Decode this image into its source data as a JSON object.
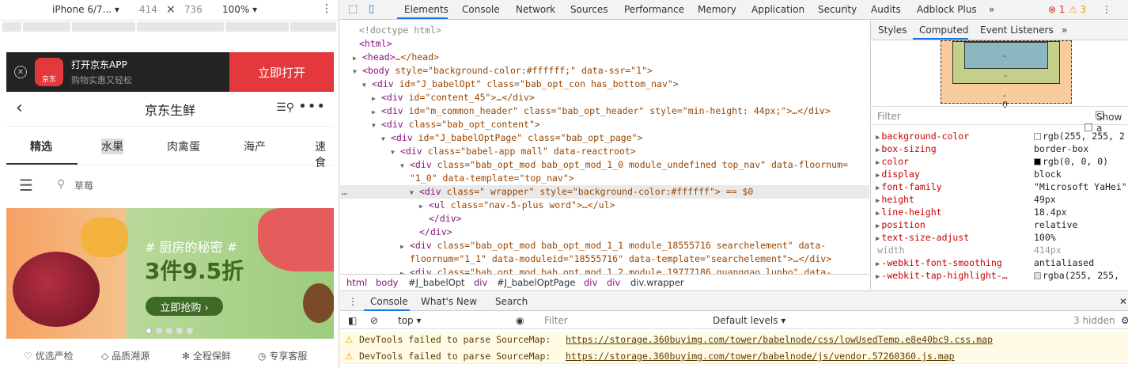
{
  "device_toolbar": {
    "device": "iPhone 6/7... ▾",
    "width": "414",
    "times": "×",
    "height": "736",
    "zoom": "100% ▾",
    "more": "⋮"
  },
  "phone": {
    "app_banner": {
      "close": "✕",
      "logo": "京东",
      "title": "打开京东APP",
      "subtitle": "购物实惠又轻松",
      "open_button": "立即打开"
    },
    "header": {
      "back": "‹",
      "title": "京东生鲜",
      "search_menu": "☰⚲",
      "more": "•••"
    },
    "categories": [
      {
        "label": "精选"
      },
      {
        "label": "水果"
      },
      {
        "label": "肉禽蛋"
      },
      {
        "label": "海产"
      },
      {
        "label": "速食"
      }
    ],
    "search": {
      "menu": "☰",
      "icon": "⚲",
      "placeholder": "草莓"
    },
    "banner": {
      "tag": "# 厨房的秘密 #",
      "headline": "3件9.5折",
      "button": "立即抢购 ›",
      "active_dot": 0,
      "dot_count": 5
    },
    "trust": [
      {
        "icon": "♡",
        "label": "优选严检"
      },
      {
        "icon": "◇",
        "label": "品质溯源"
      },
      {
        "icon": "✻",
        "label": "全程保鲜"
      },
      {
        "icon": "◷",
        "label": "专享客服"
      }
    ]
  },
  "devtools": {
    "tabs": [
      "Elements",
      "Console",
      "Network",
      "Sources",
      "Performance",
      "Memory",
      "Application",
      "Security",
      "Audits",
      "Adblock Plus",
      "»"
    ],
    "errors": "⊗ 1",
    "warnings": "⚠ 3",
    "more": "⋮",
    "close": "✕",
    "elements": [
      {
        "prefix": "",
        "tag": "<!doctype html>",
        "rest": ""
      },
      {
        "prefix": "",
        "tag": "<html>",
        "rest": ""
      },
      {
        "prefix": "▶",
        "tag": "<head>",
        "rest": "…</head>"
      },
      {
        "prefix": "▼",
        "tag": "<body",
        "rest": " style=\"background-color:#ffffff;\" data-ssr=\"1\">"
      },
      {
        "prefix": "▼",
        "tag": "<div",
        "rest": " id=\"J_babelOpt\" class=\"bab_opt_con  has_bottom_nav\">"
      },
      {
        "prefix": "▶",
        "tag": "<div",
        "rest": " id=\"content_45\">…</div>"
      },
      {
        "prefix": "▶",
        "tag": "<div",
        "rest": " id=\"m_common_header\" class=\"bab_opt_header\" style=\"min-height: 44px;\">…</div>"
      },
      {
        "prefix": "▼",
        "tag": "<div",
        "rest": " class=\"bab_opt_content\">"
      },
      {
        "prefix": "▼",
        "tag": "<div",
        "rest": " id=\"J_babelOptPage\" class=\"bab_opt_page\">"
      },
      {
        "prefix": "▼",
        "tag": "<div",
        "rest": " class=\"babel-app mall\" data-reactroot>"
      },
      {
        "prefix": "▼",
        "tag": "<div",
        "rest": " class=\"bab_opt_mod bab_opt_mod_1_0 module_undefined top_nav\" data-floornum="
      },
      {
        "prefix": "",
        "tag": "",
        "rest": "\"1_0\" data-template=\"top_nav\">"
      },
      {
        "prefix": "▼",
        "tag": "<div",
        "rest": " class=\" wrapper\" style=\"background-color:#ffffff\"> == $0"
      },
      {
        "prefix": "▶",
        "tag": "<ul",
        "rest": " class=\"nav-5-plus word\">…</ul>"
      },
      {
        "prefix": "",
        "tag": "</div>",
        "rest": ""
      },
      {
        "prefix": "",
        "tag": "</div>",
        "rest": ""
      },
      {
        "prefix": "▶",
        "tag": "<div",
        "rest": " class=\"bab_opt_mod bab_opt_mod_1_1 module_18555716 searchelement\" data-"
      },
      {
        "prefix": "",
        "tag": "",
        "rest": "floornum=\"1_1\" data-moduleid=\"18555716\" data-template=\"searchelement\">…</div>"
      },
      {
        "prefix": "▶",
        "tag": "<div",
        "rest": " class=\"bab opt mod bab opt mod 1 2 module 19777186 guanggao lunbo\" data-"
      }
    ],
    "breadcrumb": [
      "html",
      "body",
      "#J_babelOpt",
      "div",
      "#J_babelOptPage",
      "div",
      "div",
      "div.wrapper"
    ],
    "side_tabs": [
      "Styles",
      "Computed",
      "Event Listeners",
      "»"
    ],
    "box_model": {
      "content": "-",
      "padding": "-",
      "border": "-",
      "margin_bottom": "0"
    },
    "filter": {
      "placeholder": "Filter",
      "show_all": "Show a"
    },
    "computed": [
      {
        "name": "background-color",
        "value": "rgb(255, 255, 2",
        "swatch": "#ffffff",
        "dim": false
      },
      {
        "name": "box-sizing",
        "value": "border-box",
        "swatch": "",
        "dim": false
      },
      {
        "name": "color",
        "value": "rgb(0, 0, 0)",
        "swatch": "#000000",
        "dim": false
      },
      {
        "name": "display",
        "value": "block",
        "swatch": "",
        "dim": false
      },
      {
        "name": "font-family",
        "value": "\"Microsoft YaHei\"",
        "swatch": "",
        "dim": false
      },
      {
        "name": "height",
        "value": "49px",
        "swatch": "",
        "dim": false
      },
      {
        "name": "line-height",
        "value": "18.4px",
        "swatch": "",
        "dim": false
      },
      {
        "name": "position",
        "value": "relative",
        "swatch": "",
        "dim": false
      },
      {
        "name": "text-size-adjust",
        "value": "100%",
        "swatch": "",
        "dim": false
      },
      {
        "name": "width",
        "value": "414px",
        "swatch": "",
        "dim": true
      },
      {
        "name": "-webkit-font-smoothing",
        "value": "antialiased",
        "swatch": "",
        "dim": false
      },
      {
        "name": "-webkit-tap-highlight-…",
        "value": "rgba(255, 255,",
        "swatch": "#dddddd",
        "dim": false
      }
    ],
    "console": {
      "tabs": [
        "Console",
        "What's New",
        "Search"
      ],
      "context": "top ▾",
      "filter_placeholder": "Filter",
      "levels": "Default levels ▾",
      "hidden": "3 hidden",
      "messages": [
        {
          "text": "DevTools failed to parse SourceMap:",
          "url": "https://storage.360buyimg.com/tower/babelnode/css/lowUsedTemp.e8e40bc9.css.map"
        },
        {
          "text": "DevTools failed to parse SourceMap:",
          "url": "https://storage.360buyimg.com/tower/babelnode/js/vendor.57260360.js.map"
        }
      ]
    }
  }
}
